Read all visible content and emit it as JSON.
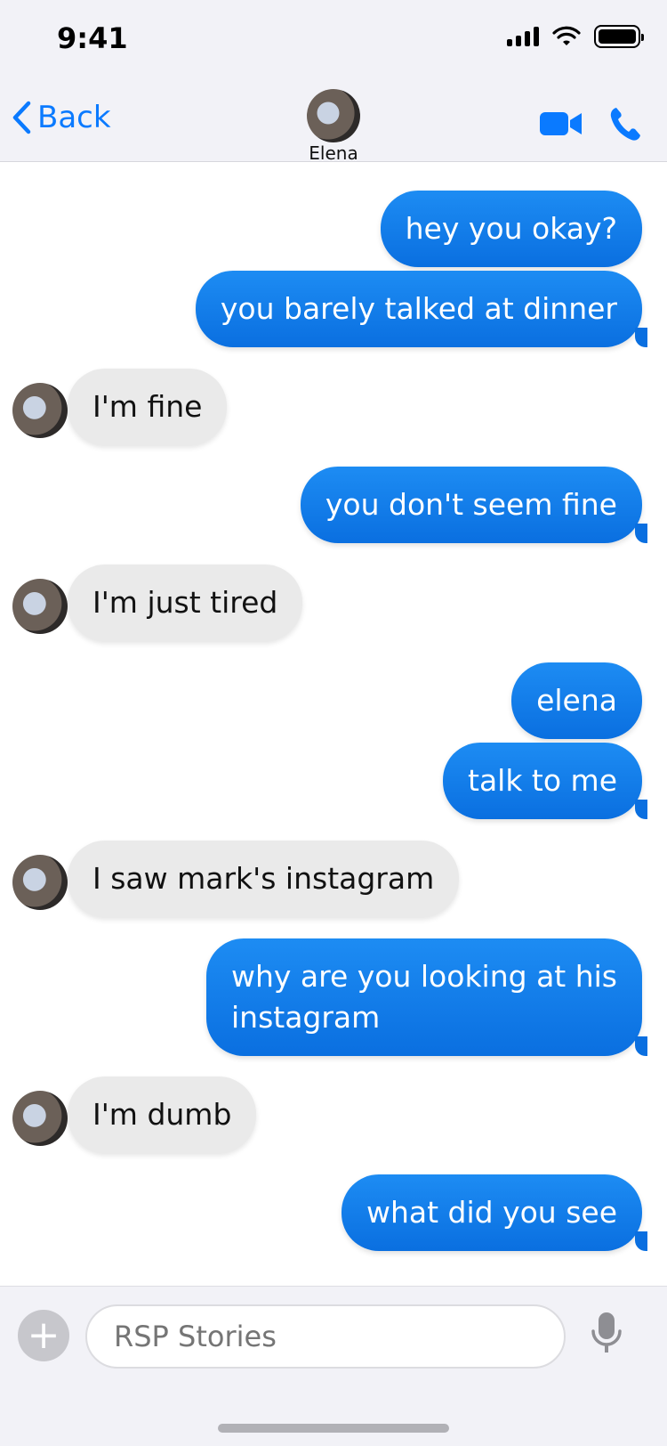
{
  "status_bar": {
    "time": "9:41"
  },
  "header": {
    "back_label": "Back",
    "contact_name": "Elena",
    "icons": {
      "back": "chevron-left-icon",
      "video": "video-camera-icon",
      "phone": "phone-icon"
    },
    "accent_color": "#0a7aff"
  },
  "messages": [
    {
      "from": "me",
      "text": "hey you okay?"
    },
    {
      "from": "me",
      "text": "you barely talked at dinner"
    },
    {
      "from": "Elena",
      "text": "I'm fine"
    },
    {
      "from": "me",
      "text": "you don't seem fine"
    },
    {
      "from": "Elena",
      "text": "I'm just tired"
    },
    {
      "from": "me",
      "text": "elena"
    },
    {
      "from": "me",
      "text": "talk to me"
    },
    {
      "from": "Elena",
      "text": "I saw mark's instagram"
    },
    {
      "from": "me",
      "text": "why are you looking at his\ninstagram"
    },
    {
      "from": "Elena",
      "text": "I'm dumb"
    },
    {
      "from": "me",
      "text": "what did you see"
    }
  ],
  "composer": {
    "placeholder": "RSP Stories",
    "icons": {
      "add": "plus-icon",
      "mic": "microphone-icon"
    }
  },
  "colors": {
    "sent_bubble": "#0a7aff",
    "received_bubble": "#eaeaea"
  }
}
